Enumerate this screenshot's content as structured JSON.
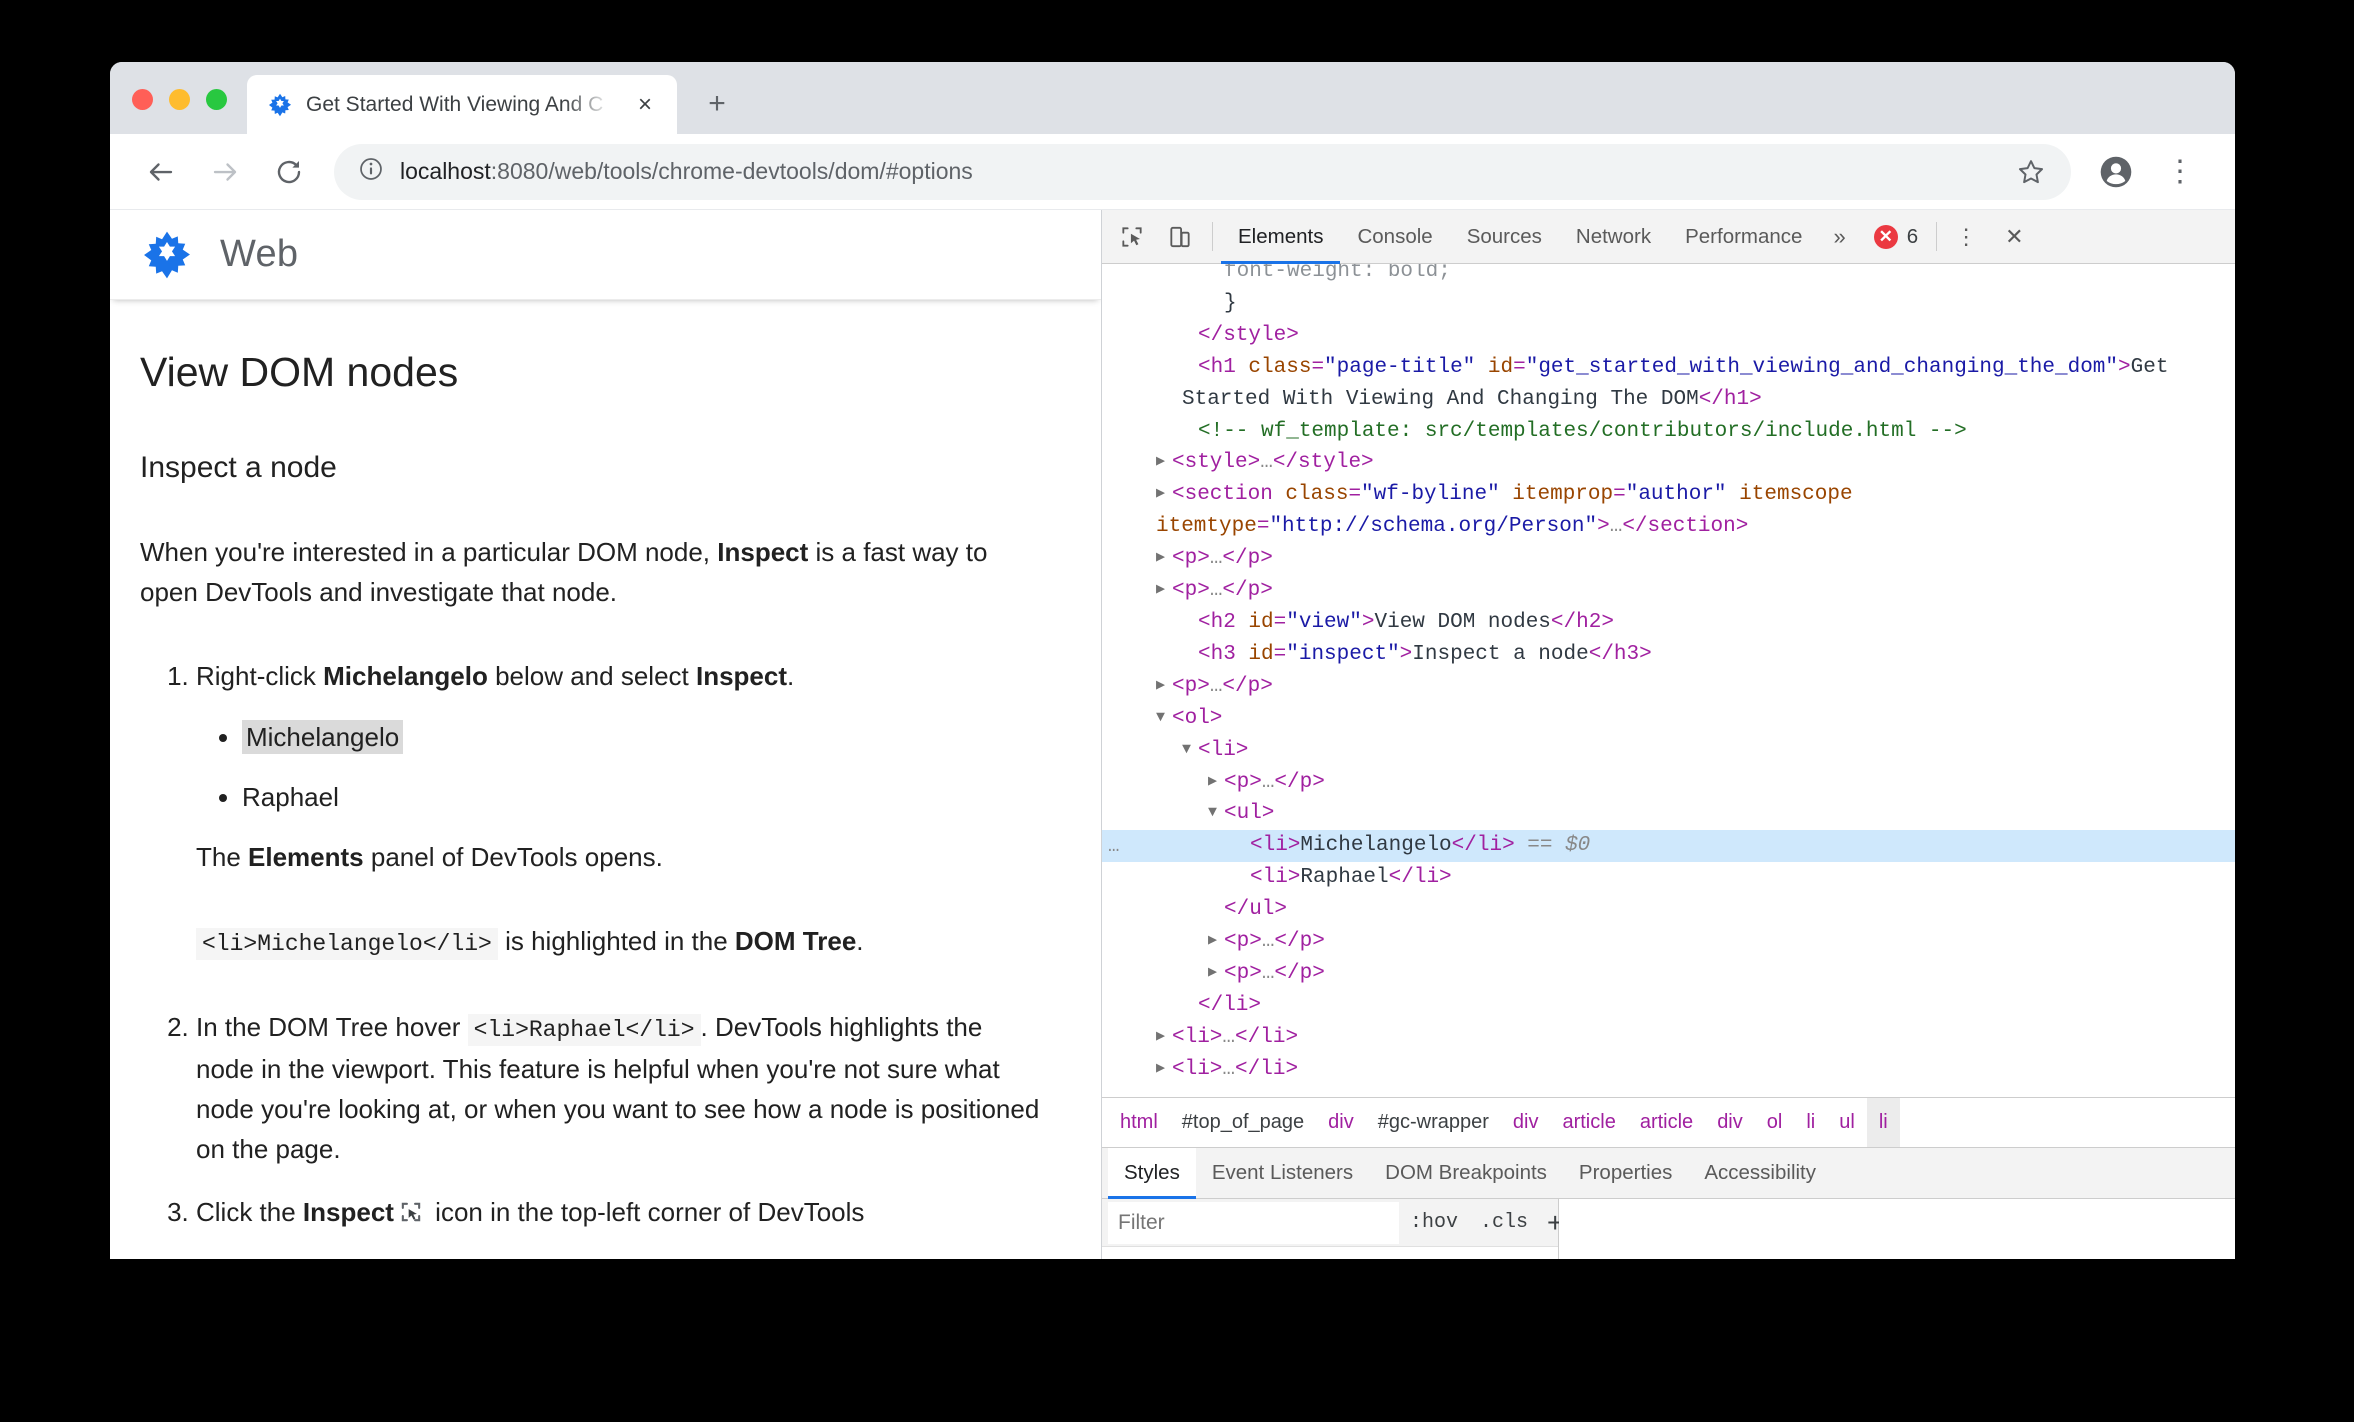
{
  "browser": {
    "tab": {
      "title": "Get Started With Viewing And C",
      "favicon_name": "web-fundamentals-favicon",
      "close_label": "×"
    },
    "newtab_label": "+",
    "toolbar": {
      "back_label": "←",
      "forward_label": "→",
      "reload_label": "↻",
      "info_label": "ⓘ",
      "url_host": "localhost",
      "url_rest": ":8080/web/tools/chrome-devtools/dom/#options",
      "star_label": "☆",
      "menu_label": "⋮"
    }
  },
  "page": {
    "brand": "Web",
    "h2": "View DOM nodes",
    "h3": "Inspect a node",
    "intro_a": "When you're interested in a particular DOM node, ",
    "intro_b": "Inspect",
    "intro_c": " is a fast way to open DevTools and investigate that node.",
    "step1_a": "Right-click ",
    "step1_b": "Michelangelo",
    "step1_c": " below and select ",
    "step1_d": "Inspect",
    "step1_e": ".",
    "names": [
      "Michelangelo",
      "Raphael"
    ],
    "step1_note_a": "The ",
    "step1_note_b": "Elements",
    "step1_note_c": " panel of DevTools opens.",
    "step1_code": "<li>Michelangelo</li>",
    "step1_code_a": " is highlighted in the ",
    "step1_code_b": "DOM Tree",
    "step1_code_c": ".",
    "step2_a": "In the DOM Tree hover ",
    "step2_code": "<li>Raphael</li>",
    "step2_b": ". DevTools highlights the node in the viewport. This feature is helpful when you're not sure what node you're looking at, or when you want to see how a node is positioned on the page.",
    "step3_a": "Click the ",
    "step3_b": "Inspect",
    "step3_icon_name": "inspect-cursor-icon",
    "step3_c": " icon in the top-left corner of DevTools"
  },
  "devtools": {
    "toolbar": {
      "inspect_icon_name": "inspect-element-icon",
      "device_icon_name": "device-toolbar-icon",
      "tabs": [
        {
          "label": "Elements",
          "active": true
        },
        {
          "label": "Console",
          "active": false
        },
        {
          "label": "Sources",
          "active": false
        },
        {
          "label": "Network",
          "active": false
        },
        {
          "label": "Performance",
          "active": false
        }
      ],
      "overflow_label": "»",
      "error_count": "6",
      "error_glyph": "✕",
      "menu_label": "⋮",
      "close_label": "✕"
    },
    "tree": [
      {
        "indent": 3,
        "arrow": "none",
        "parts": [
          {
            "t": "tx",
            "v": "font-weight: bold;"
          }
        ],
        "clipped": true
      },
      {
        "indent": 3,
        "arrow": "none",
        "parts": [
          {
            "t": "tx",
            "v": "}"
          }
        ]
      },
      {
        "indent": 2,
        "arrow": "none",
        "parts": [
          {
            "t": "tg",
            "v": "</style>"
          }
        ]
      },
      {
        "indent": 2,
        "arrow": "none",
        "parts": [
          {
            "t": "tg",
            "v": "<h1 "
          },
          {
            "t": "at",
            "v": "class"
          },
          {
            "t": "tg",
            "v": "="
          },
          {
            "t": "av",
            "v": "\"page-title\""
          },
          {
            "t": "tg",
            "v": " "
          },
          {
            "t": "at",
            "v": "id"
          },
          {
            "t": "tg",
            "v": "="
          },
          {
            "t": "av",
            "v": "\"get_started_with_viewing_and_changing_the_dom\""
          },
          {
            "t": "tg",
            "v": ">"
          },
          {
            "t": "tx",
            "v": "Get Started With Viewing And Changing The DOM"
          },
          {
            "t": "tg",
            "v": "</h1>"
          }
        ]
      },
      {
        "indent": 2,
        "arrow": "none",
        "parts": [
          {
            "t": "cm",
            "v": "<!-- wf_template: src/templates/contributors/include.html -->"
          }
        ]
      },
      {
        "indent": 1,
        "arrow": "right",
        "parts": [
          {
            "t": "tg",
            "v": "<style>"
          },
          {
            "t": "pn",
            "v": "…"
          },
          {
            "t": "tg",
            "v": "</style>"
          }
        ]
      },
      {
        "indent": 1,
        "arrow": "right",
        "parts": [
          {
            "t": "tg",
            "v": "<section "
          },
          {
            "t": "at",
            "v": "class"
          },
          {
            "t": "tg",
            "v": "="
          },
          {
            "t": "av",
            "v": "\"wf-byline\""
          },
          {
            "t": "tg",
            "v": " "
          },
          {
            "t": "at",
            "v": "itemprop"
          },
          {
            "t": "tg",
            "v": "="
          },
          {
            "t": "av",
            "v": "\"author\""
          },
          {
            "t": "tg",
            "v": " "
          },
          {
            "t": "at",
            "v": "itemscope"
          },
          {
            "t": "tg",
            "v": " "
          },
          {
            "t": "at",
            "v": "itemtype"
          },
          {
            "t": "tg",
            "v": "="
          },
          {
            "t": "av",
            "v": "\"http://schema.org/Person\""
          },
          {
            "t": "tg",
            "v": ">"
          },
          {
            "t": "pn",
            "v": "…"
          },
          {
            "t": "tg",
            "v": "</section>"
          }
        ]
      },
      {
        "indent": 1,
        "arrow": "right",
        "parts": [
          {
            "t": "tg",
            "v": "<p>"
          },
          {
            "t": "pn",
            "v": "…"
          },
          {
            "t": "tg",
            "v": "</p>"
          }
        ]
      },
      {
        "indent": 1,
        "arrow": "right",
        "parts": [
          {
            "t": "tg",
            "v": "<p>"
          },
          {
            "t": "pn",
            "v": "…"
          },
          {
            "t": "tg",
            "v": "</p>"
          }
        ]
      },
      {
        "indent": 2,
        "arrow": "none",
        "parts": [
          {
            "t": "tg",
            "v": "<h2 "
          },
          {
            "t": "at",
            "v": "id"
          },
          {
            "t": "tg",
            "v": "="
          },
          {
            "t": "av",
            "v": "\"view\""
          },
          {
            "t": "tg",
            "v": ">"
          },
          {
            "t": "tx",
            "v": "View DOM nodes"
          },
          {
            "t": "tg",
            "v": "</h2>"
          }
        ]
      },
      {
        "indent": 2,
        "arrow": "none",
        "parts": [
          {
            "t": "tg",
            "v": "<h3 "
          },
          {
            "t": "at",
            "v": "id"
          },
          {
            "t": "tg",
            "v": "="
          },
          {
            "t": "av",
            "v": "\"inspect\""
          },
          {
            "t": "tg",
            "v": ">"
          },
          {
            "t": "tx",
            "v": "Inspect a node"
          },
          {
            "t": "tg",
            "v": "</h3>"
          }
        ]
      },
      {
        "indent": 1,
        "arrow": "right",
        "parts": [
          {
            "t": "tg",
            "v": "<p>"
          },
          {
            "t": "pn",
            "v": "…"
          },
          {
            "t": "tg",
            "v": "</p>"
          }
        ]
      },
      {
        "indent": 1,
        "arrow": "down",
        "parts": [
          {
            "t": "tg",
            "v": "<ol>"
          }
        ]
      },
      {
        "indent": 2,
        "arrow": "down",
        "parts": [
          {
            "t": "tg",
            "v": "<li>"
          }
        ]
      },
      {
        "indent": 3,
        "arrow": "right",
        "parts": [
          {
            "t": "tg",
            "v": "<p>"
          },
          {
            "t": "pn",
            "v": "…"
          },
          {
            "t": "tg",
            "v": "</p>"
          }
        ]
      },
      {
        "indent": 3,
        "arrow": "down",
        "parts": [
          {
            "t": "tg",
            "v": "<ul>"
          }
        ]
      },
      {
        "indent": 4,
        "arrow": "none",
        "selected": true,
        "dots": "…",
        "parts": [
          {
            "t": "tg",
            "v": "<li>"
          },
          {
            "t": "tx",
            "v": "Michelangelo"
          },
          {
            "t": "tg",
            "v": "</li>"
          },
          {
            "t": "sel0",
            "v": " == $0"
          }
        ]
      },
      {
        "indent": 4,
        "arrow": "none",
        "parts": [
          {
            "t": "tg",
            "v": "<li>"
          },
          {
            "t": "tx",
            "v": "Raphael"
          },
          {
            "t": "tg",
            "v": "</li>"
          }
        ]
      },
      {
        "indent": 3,
        "arrow": "none",
        "parts": [
          {
            "t": "tg",
            "v": "</ul>"
          }
        ]
      },
      {
        "indent": 3,
        "arrow": "right",
        "parts": [
          {
            "t": "tg",
            "v": "<p>"
          },
          {
            "t": "pn",
            "v": "…"
          },
          {
            "t": "tg",
            "v": "</p>"
          }
        ]
      },
      {
        "indent": 3,
        "arrow": "right",
        "parts": [
          {
            "t": "tg",
            "v": "<p>"
          },
          {
            "t": "pn",
            "v": "…"
          },
          {
            "t": "tg",
            "v": "</p>"
          }
        ]
      },
      {
        "indent": 2,
        "arrow": "none",
        "parts": [
          {
            "t": "tg",
            "v": "</li>"
          }
        ]
      },
      {
        "indent": 1,
        "arrow": "right",
        "parts": [
          {
            "t": "tg",
            "v": "<li>"
          },
          {
            "t": "pn",
            "v": "…"
          },
          {
            "t": "tg",
            "v": "</li>"
          }
        ]
      },
      {
        "indent": 1,
        "arrow": "right",
        "parts": [
          {
            "t": "tg",
            "v": "<li>"
          },
          {
            "t": "pn",
            "v": "…"
          },
          {
            "t": "tg",
            "v": "</li>"
          }
        ]
      }
    ],
    "breadcrumbs": [
      {
        "label": "html",
        "type": "tag"
      },
      {
        "label": "#top_of_page",
        "type": "id"
      },
      {
        "label": "div",
        "type": "tag"
      },
      {
        "label": "#gc-wrapper",
        "type": "id"
      },
      {
        "label": "div",
        "type": "tag"
      },
      {
        "label": "article",
        "type": "tag"
      },
      {
        "label": "article",
        "type": "tag"
      },
      {
        "label": "div",
        "type": "tag"
      },
      {
        "label": "ol",
        "type": "tag"
      },
      {
        "label": "li",
        "type": "tag"
      },
      {
        "label": "ul",
        "type": "tag"
      },
      {
        "label": "li",
        "type": "tag",
        "active": true
      }
    ],
    "sidebar_tabs": [
      {
        "label": "Styles",
        "active": true
      },
      {
        "label": "Event Listeners",
        "active": false
      },
      {
        "label": "DOM Breakpoints",
        "active": false
      },
      {
        "label": "Properties",
        "active": false
      },
      {
        "label": "Accessibility",
        "active": false
      }
    ],
    "filter": {
      "placeholder": "Filter",
      "value": "",
      "hov_label": ":hov",
      "cls_label": ".cls",
      "plus_label": "+"
    }
  },
  "colors": {
    "accent": "#1a73e8",
    "selection": "#cfe8fc",
    "error": "#eb3941",
    "tag": "#a020a0",
    "attr_name": "#994500",
    "attr_value": "#1a1aa6",
    "comment": "#236e25",
    "brand_blue": "#1a73e8",
    "highlight_gray": "#dadada",
    "margin_box": "#f7cd9b"
  }
}
